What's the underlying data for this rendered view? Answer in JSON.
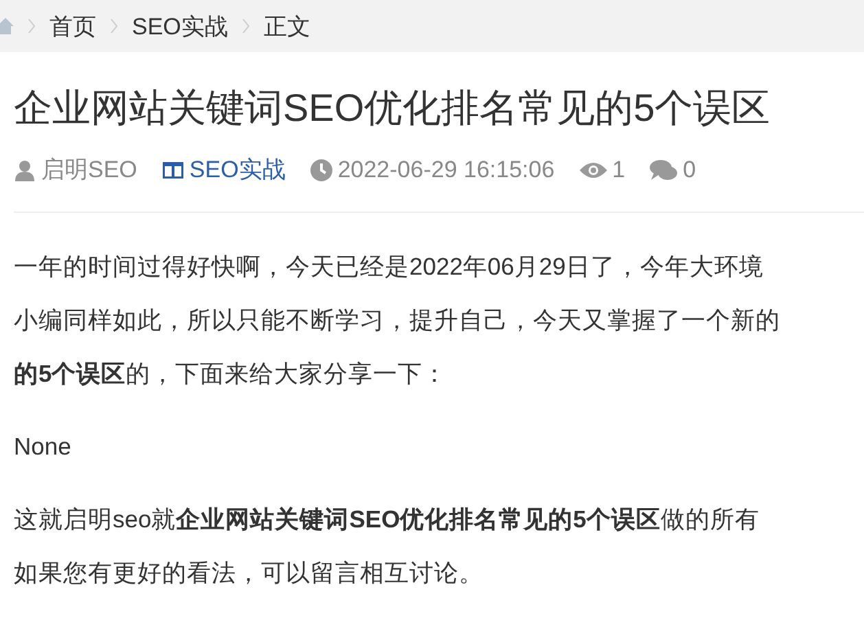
{
  "breadcrumb": [
    "首页",
    "SEO实战",
    "正文"
  ],
  "title": "企业网站关键词SEO优化排名常见的5个误区",
  "meta": {
    "author": "启明SEO",
    "category": "SEO实战",
    "date": "2022-06-29 16:15:06",
    "views": "1",
    "comments": "0"
  },
  "paragraphs": [
    {
      "lines": [
        "一年的时间过得好快啊，今天已经是2022年06月29日了，今年大环境",
        "小编同样如此，所以只能不断学习，提升自己，今天又掌握了一个新的",
        "**的5个误区**的，下面来给大家分享一下："
      ]
    },
    {
      "lines": [
        "None"
      ]
    },
    {
      "lines": [
        "这就启明seo就**企业网站关键词SEO优化排名常见的5个误区**做的所有",
        "如果您有更好的看法，可以留言相互讨论。"
      ]
    }
  ]
}
